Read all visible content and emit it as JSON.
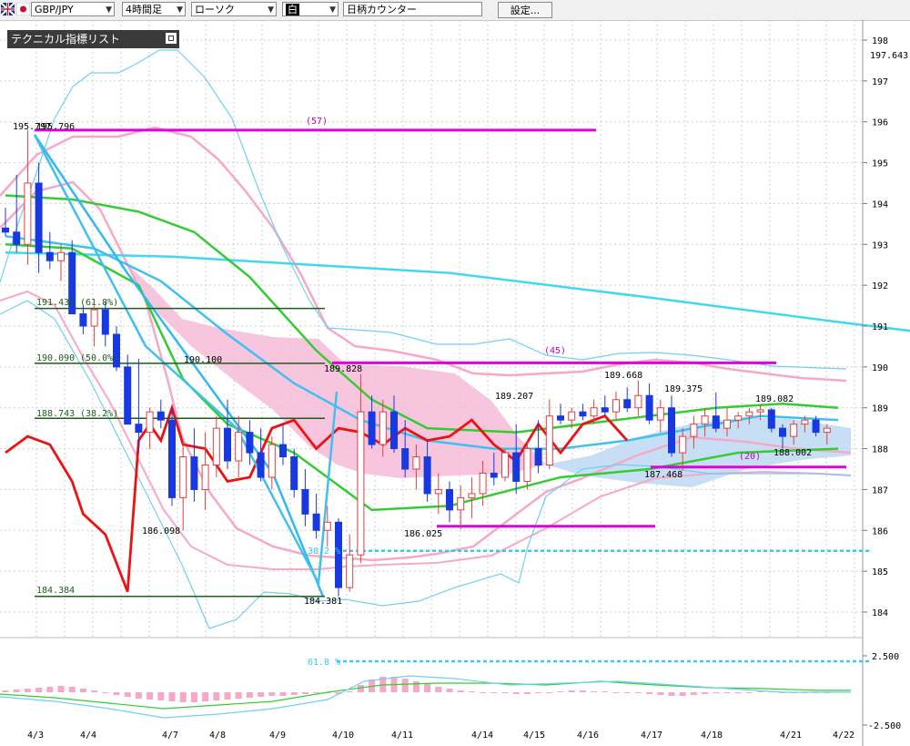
{
  "toolbar": {
    "pair": "GBP/JPY",
    "timeframe": "4時間足",
    "chart_kind": "ローソク",
    "style": "白",
    "counter": "日柄カウンター",
    "settings": "設定..."
  },
  "panel": {
    "title": "テクニカル指標リスト"
  },
  "chart_data": {
    "type": "candlestick",
    "instrument": "GBP/JPY",
    "timeframe": "4時間足",
    "y_axis": {
      "range": [
        183.5,
        198.3
      ],
      "ticks": [
        "198",
        "197",
        "196",
        "195",
        "194",
        "193",
        "192",
        "191",
        "190",
        "189",
        "188",
        "187",
        "186",
        "185",
        "184"
      ],
      "current_price": "197.643"
    },
    "x_axis": {
      "ticks": [
        "4/3",
        "4/4",
        "4/7",
        "4/8",
        "4/9",
        "4/10",
        "4/11",
        "4/14",
        "4/15",
        "4/16",
        "4/17",
        "4/18",
        "4/21",
        "4/22"
      ]
    },
    "price_labels": [
      "195.797",
      "195.796",
      "191.431",
      "(61.8%)",
      "190.090",
      "(50.0%)",
      "190.100",
      "188.743",
      "(38.2%)",
      "189.828",
      "189.207",
      "189.668",
      "189.375",
      "189.082",
      "188.002",
      "187.468",
      "186.098",
      "186.025",
      "184.384",
      "184.381"
    ],
    "fibonacci": [
      {
        "price": 191.431,
        "label": "191.431",
        "pct": "(61.8%)"
      },
      {
        "price": 190.09,
        "label": "190.090",
        "pct": "(50.0%)"
      },
      {
        "price": 188.743,
        "label": "188.743",
        "pct": "(38.2%)"
      },
      {
        "price": 184.384,
        "label": "184.384",
        "pct": ""
      }
    ],
    "fib_ext_labels": [
      "38.2 %",
      "61.8 %"
    ],
    "count_labels": [
      "(57)",
      "(45)",
      "(20)"
    ],
    "indicator_axis": {
      "ticks": [
        "2.500",
        "-2.500"
      ]
    },
    "candles": [
      [
        193.4,
        193.9,
        193.2,
        193.3
      ],
      [
        193.3,
        194.7,
        192.8,
        193.0
      ],
      [
        193.0,
        195.8,
        192.5,
        194.5
      ],
      [
        194.5,
        195.0,
        192.3,
        192.8
      ],
      [
        192.8,
        193.3,
        192.4,
        192.6
      ],
      [
        192.6,
        193.0,
        192.1,
        192.8
      ],
      [
        192.8,
        193.1,
        191.6,
        191.3
      ],
      [
        191.3,
        191.5,
        190.8,
        191.0
      ],
      [
        191.0,
        191.5,
        190.5,
        191.4
      ],
      [
        191.4,
        191.6,
        190.5,
        190.8
      ],
      [
        190.8,
        191.0,
        189.9,
        190.0
      ],
      [
        190.0,
        190.3,
        188.6,
        188.6
      ],
      [
        188.6,
        190.2,
        187.9,
        188.4
      ],
      [
        188.4,
        189.0,
        188.0,
        188.9
      ],
      [
        188.9,
        189.2,
        188.5,
        188.7
      ],
      [
        188.7,
        189.0,
        186.6,
        186.8
      ],
      [
        186.8,
        188.2,
        186.0,
        187.8
      ],
      [
        187.8,
        188.5,
        186.7,
        187.0
      ],
      [
        187.0,
        188.4,
        186.5,
        187.6
      ],
      [
        187.6,
        188.8,
        187.3,
        188.5
      ],
      [
        188.5,
        189.2,
        187.5,
        187.7
      ],
      [
        187.7,
        188.8,
        187.3,
        188.4
      ],
      [
        188.4,
        188.7,
        187.6,
        187.9
      ],
      [
        187.9,
        188.5,
        187.2,
        187.3
      ],
      [
        187.3,
        188.3,
        187.0,
        188.1
      ],
      [
        188.1,
        188.6,
        187.6,
        187.8
      ],
      [
        187.8,
        188.0,
        186.8,
        187.0
      ],
      [
        187.0,
        187.5,
        186.1,
        186.4
      ],
      [
        186.4,
        186.9,
        185.8,
        186.0
      ],
      [
        186.0,
        186.6,
        185.6,
        186.2
      ],
      [
        186.2,
        186.3,
        184.381,
        184.6
      ],
      [
        184.6,
        185.9,
        184.5,
        185.4
      ],
      [
        185.4,
        189.83,
        185.2,
        188.9
      ],
      [
        188.9,
        189.3,
        188.0,
        188.1
      ],
      [
        188.1,
        189.2,
        187.8,
        188.9
      ],
      [
        188.9,
        189.3,
        187.9,
        188.0
      ],
      [
        188.0,
        188.7,
        187.3,
        187.5
      ],
      [
        187.5,
        188.1,
        187.0,
        187.8
      ],
      [
        187.8,
        188.2,
        186.7,
        186.9
      ],
      [
        186.9,
        187.4,
        186.4,
        187.0
      ],
      [
        187.0,
        187.2,
        186.2,
        186.5
      ],
      [
        186.5,
        187.1,
        186.025,
        186.8
      ],
      [
        186.8,
        187.3,
        186.3,
        186.9
      ],
      [
        186.9,
        187.7,
        186.6,
        187.4
      ],
      [
        187.4,
        187.9,
        187.1,
        187.3
      ],
      [
        187.3,
        188.0,
        187.2,
        187.9
      ],
      [
        187.9,
        188.6,
        186.9,
        187.2
      ],
      [
        187.2,
        188.2,
        187.0,
        188.0
      ],
      [
        188.0,
        188.7,
        187.4,
        187.6
      ],
      [
        187.6,
        189.207,
        187.5,
        188.8
      ],
      [
        188.8,
        189.1,
        188.6,
        188.7
      ],
      [
        188.7,
        189.0,
        188.5,
        188.9
      ],
      [
        188.9,
        189.1,
        188.7,
        188.8
      ],
      [
        188.8,
        189.2,
        188.6,
        189.0
      ],
      [
        189.0,
        189.3,
        188.8,
        188.9
      ],
      [
        188.9,
        189.4,
        188.7,
        189.2
      ],
      [
        189.2,
        189.5,
        188.9,
        189.0
      ],
      [
        189.0,
        189.668,
        188.8,
        189.3
      ],
      [
        189.3,
        189.6,
        188.6,
        188.7
      ],
      [
        188.7,
        189.2,
        188.4,
        189.0
      ],
      [
        189.0,
        189.3,
        187.8,
        187.9
      ],
      [
        187.9,
        188.5,
        187.468,
        188.3
      ],
      [
        188.3,
        188.8,
        188.0,
        188.6
      ],
      [
        188.6,
        189.0,
        188.3,
        188.8
      ],
      [
        188.8,
        189.375,
        188.4,
        188.5
      ],
      [
        188.5,
        189.0,
        188.3,
        188.7
      ],
      [
        188.7,
        188.9,
        188.5,
        188.8
      ],
      [
        188.8,
        189.0,
        188.6,
        188.9
      ],
      [
        188.9,
        189.082,
        188.7,
        188.95
      ],
      [
        188.95,
        189.0,
        188.4,
        188.5
      ],
      [
        188.5,
        188.6,
        188.002,
        188.3
      ],
      [
        188.3,
        188.7,
        188.1,
        188.6
      ],
      [
        188.6,
        188.8,
        188.4,
        188.7
      ],
      [
        188.7,
        188.8,
        188.3,
        188.4
      ],
      [
        188.4,
        188.6,
        188.1,
        188.5
      ]
    ],
    "series": [
      {
        "kind": "ma-long",
        "color": "#40d8f0",
        "values": [
          [
            0,
            192.8
          ],
          [
            15,
            192.7
          ],
          [
            40,
            192.3
          ],
          [
            58,
            191.7
          ],
          [
            75,
            191.1
          ],
          [
            93,
            190.5
          ]
        ]
      },
      {
        "kind": "ma-mid",
        "color": "#40c0f0",
        "values": [
          [
            0,
            193.2
          ],
          [
            8,
            192.9
          ],
          [
            14,
            192.1
          ],
          [
            20,
            190.8
          ],
          [
            26,
            189.6
          ],
          [
            32,
            188.7
          ],
          [
            38,
            188.2
          ],
          [
            44,
            188.0
          ],
          [
            50,
            188.0
          ],
          [
            56,
            188.2
          ],
          [
            62,
            188.5
          ],
          [
            68,
            188.8
          ],
          [
            75,
            188.7
          ]
        ]
      },
      {
        "kind": "ma-green",
        "color": "#33cc33",
        "values": [
          [
            0,
            194.2
          ],
          [
            6,
            194.1
          ],
          [
            12,
            193.8
          ],
          [
            17,
            193.3
          ],
          [
            22,
            192.2
          ],
          [
            28,
            190.4
          ],
          [
            33,
            189.2
          ],
          [
            38,
            188.5
          ],
          [
            46,
            188.4
          ],
          [
            52,
            188.6
          ],
          [
            58,
            188.8
          ],
          [
            64,
            189.0
          ],
          [
            70,
            189.1
          ],
          [
            75,
            189.0
          ]
        ]
      },
      {
        "kind": "ma-green-2",
        "color": "#33cc33",
        "values": [
          [
            0,
            193.0
          ],
          [
            6,
            192.9
          ],
          [
            12,
            192.0
          ],
          [
            16,
            189.7
          ],
          [
            20,
            188.6
          ],
          [
            26,
            187.9
          ],
          [
            33,
            186.5
          ],
          [
            40,
            186.6
          ],
          [
            50,
            187.3
          ],
          [
            58,
            187.5
          ],
          [
            66,
            187.9
          ],
          [
            75,
            188.0
          ]
        ]
      },
      {
        "kind": "chikou",
        "color": "#ee1111",
        "values": [
          [
            0,
            187.9
          ],
          [
            2,
            188.3
          ],
          [
            4,
            188.1
          ],
          [
            6,
            187.2
          ],
          [
            7,
            186.4
          ],
          [
            9,
            185.9
          ],
          [
            11,
            184.5
          ],
          [
            12,
            188.2
          ],
          [
            13,
            188.6
          ],
          [
            14,
            188.2
          ],
          [
            15,
            189.0
          ],
          [
            16,
            188.1
          ],
          [
            18,
            188.0
          ],
          [
            20,
            187.2
          ],
          [
            22,
            187.3
          ],
          [
            24,
            188.5
          ],
          [
            26,
            188.7
          ],
          [
            28,
            188.0
          ],
          [
            30,
            188.5
          ],
          [
            32,
            188.4
          ],
          [
            34,
            188.1
          ],
          [
            36,
            188.5
          ],
          [
            38,
            188.2
          ],
          [
            40,
            188.3
          ],
          [
            42,
            188.7
          ],
          [
            44,
            188.1
          ],
          [
            46,
            187.7
          ],
          [
            48,
            188.6
          ],
          [
            50,
            187.9
          ],
          [
            52,
            188.6
          ],
          [
            54,
            188.8
          ],
          [
            56,
            188.2
          ]
        ]
      }
    ]
  }
}
